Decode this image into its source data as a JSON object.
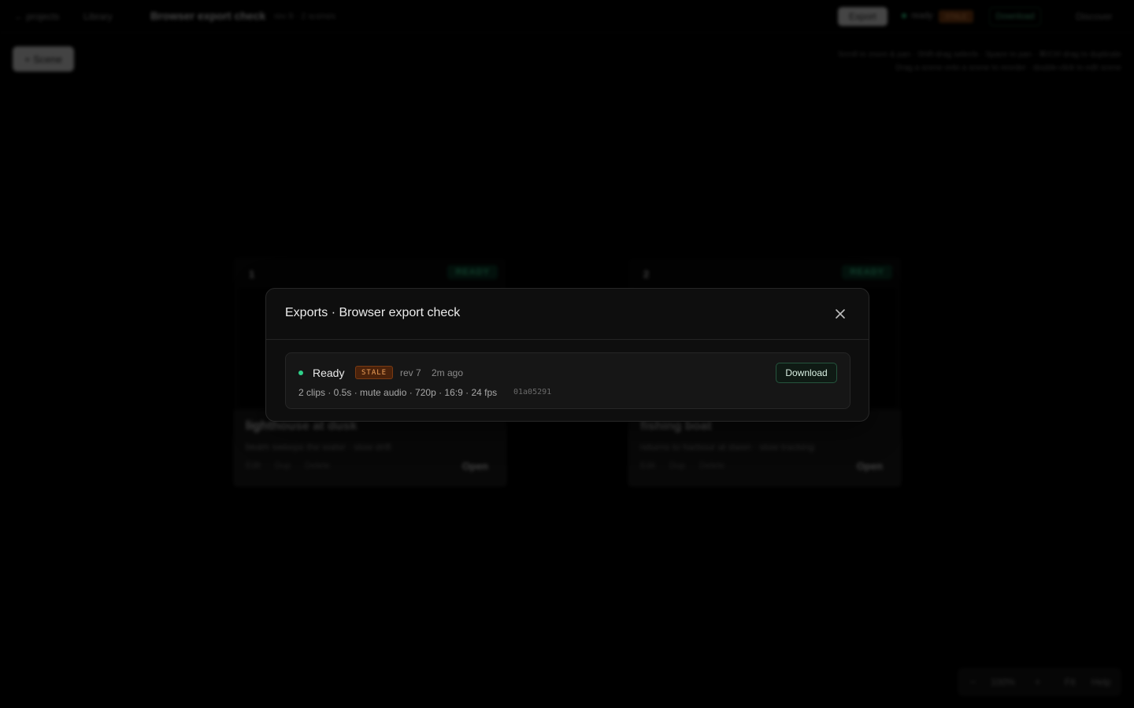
{
  "topbar": {
    "projects_link": "← projects",
    "library_link": "Library",
    "project_title": "Browser export check",
    "project_meta": "rev 8 · 2 scenes",
    "export_label": "Export",
    "status_label": "ready",
    "stale_label": "STALE",
    "download_label": "Download",
    "discover_label": "Discover"
  },
  "toolbar": {
    "add_scene_label": "+ Scene"
  },
  "hints": {
    "line1": "Scroll to zoom & pan · Shift-drag selects · Space to pan · ⌘/Ctrl drag to duplicate",
    "line2": "Drag a scene onto a scene to reorder · double-click to edit scene"
  },
  "scenes": [
    {
      "number": "1",
      "status": "READY",
      "title": "lighthouse at dusk",
      "description": "beam sweeps the water · slow drift",
      "actions": [
        "Edit",
        "Dup",
        "Delete"
      ],
      "open_label": "Open"
    },
    {
      "number": "2",
      "status": "READY",
      "title": "fishing boat",
      "description": "returns to harbour at dawn · slow tracking",
      "actions": [
        "Edit",
        "Dup",
        "Delete"
      ],
      "open_label": "Open"
    }
  ],
  "zoom": {
    "minus": "−",
    "level": "100%",
    "plus": "+",
    "fit": "Fit",
    "help": "Help"
  },
  "modal": {
    "title": "Exports · Browser export check",
    "close_icon": "close-icon",
    "export": {
      "status": "Ready",
      "badge": "STALE",
      "rev": "rev 7",
      "time": "2m ago",
      "details": "2 clips · 0.5s · mute audio · 720p · 16:9 · 24 fps",
      "hash": "01a05291",
      "download_label": "Download"
    }
  },
  "colors": {
    "ready_green": "#2fd08a",
    "stale_orange": "#f0a25a",
    "background": "#000000"
  }
}
